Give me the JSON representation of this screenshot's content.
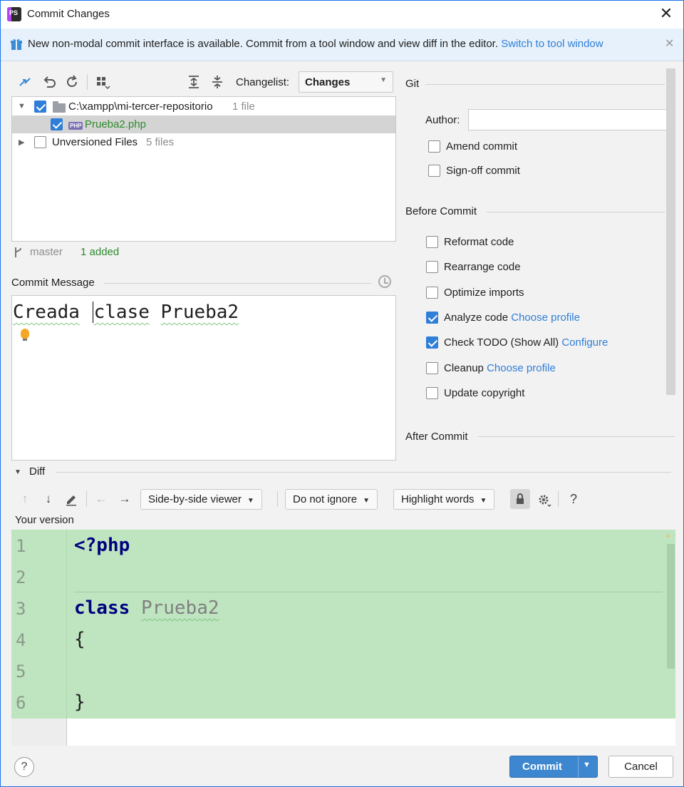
{
  "window": {
    "title": "Commit Changes",
    "close": "✕"
  },
  "banner": {
    "text": "New non-modal commit interface is available. Commit from a tool window and view diff in the editor.",
    "link": "Switch to tool window",
    "close": "✕"
  },
  "toolbar": {
    "changelist_label": "Changelist:",
    "changelist_value": "Changes"
  },
  "tree": {
    "repo": {
      "path": "C:\\xampp\\mi-tercer-repositorio",
      "count": "1 file",
      "checked": true
    },
    "file": {
      "name": "Prueba2.php",
      "checked": true,
      "icon": "PHP"
    },
    "unversioned": {
      "label": "Unversioned Files",
      "count": "5 files",
      "checked": false
    }
  },
  "status": {
    "branch": "master",
    "changes": "1 added"
  },
  "commit_message": {
    "label": "Commit Message",
    "words": [
      "Creada",
      "clase",
      "Prueba2"
    ]
  },
  "git": {
    "title": "Git",
    "author_label": "Author:",
    "author_value": "",
    "amend": "Amend commit",
    "signoff": "Sign-off commit"
  },
  "before_commit": {
    "title": "Before Commit",
    "reformat": "Reformat code",
    "rearrange": "Rearrange code",
    "optimize": "Optimize imports",
    "analyze": "Analyze code",
    "analyze_link": "Choose profile",
    "todo": "Check TODO (Show All)",
    "todo_link": "Configure",
    "cleanup": "Cleanup",
    "cleanup_link": "Choose profile",
    "copyright": "Update copyright"
  },
  "after_commit": {
    "title": "After Commit"
  },
  "diff": {
    "title": "Diff",
    "viewer": "Side-by-side viewer",
    "ignore": "Do not ignore",
    "highlight": "Highlight words",
    "help": "?",
    "your_version": "Your version",
    "line_numbers": [
      "1",
      "2",
      "3",
      "4",
      "5",
      "6"
    ],
    "code": {
      "l1": "<?php",
      "l3_kw": "class",
      "l3_name": "Prueba2",
      "l4": "{",
      "l6": "}"
    }
  },
  "footer": {
    "help": "?",
    "commit": "Commit",
    "cancel": "Cancel"
  },
  "colors": {
    "accent": "#2f7ed8",
    "added_bg": "#bfe5c0",
    "keyword": "#00007f"
  }
}
